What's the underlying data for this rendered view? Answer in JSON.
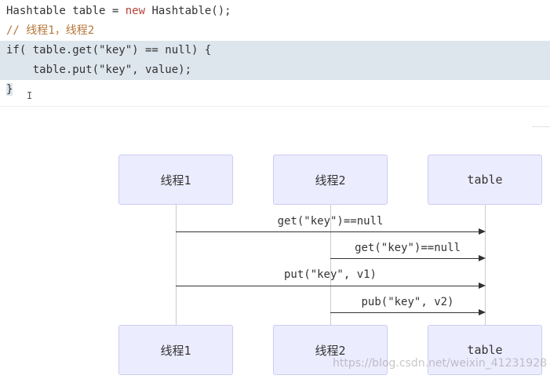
{
  "code": {
    "line1_type": "Hashtable table = ",
    "line1_new": "new",
    "line1_rest": " Hashtable();",
    "line2_comment": "// 线程1，线程2",
    "line3": "if( table.get(\"key\") == null) {",
    "line4": "    table.put(\"key\", value);",
    "line5": "}"
  },
  "diagram": {
    "actors": [
      "线程1",
      "线程2",
      "table"
    ],
    "messages": [
      "get(\"key\")==null",
      "get(\"key\")==null",
      "put(\"key\", v1)",
      "pub(\"key\", v2)"
    ]
  },
  "watermark": "https://blog.csdn.net/weixin_41231928"
}
